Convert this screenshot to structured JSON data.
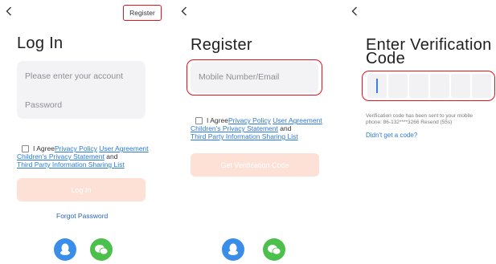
{
  "login": {
    "title": "Log In",
    "register_label": "Register",
    "account_placeholder": "Please enter your account",
    "password_placeholder": "Password",
    "agree_text": "I Agree",
    "privacy_policy": "Privacy Policy",
    "user_agreement": "User Agreement",
    "children_privacy": "Children's Privacy Statement",
    "and_text": "and",
    "third_party": "Third Party Information Sharing List",
    "login_button": "Log In",
    "forgot_password": "Forgot Password"
  },
  "register": {
    "title": "Register",
    "mobile_placeholder": "Mobile Number/Email",
    "agree_text": "I Agree",
    "privacy_policy": "Privacy Policy",
    "user_agreement": "User Agreement",
    "children_privacy": "Children's Privacy Statement",
    "and_text": "and",
    "third_party": "Third Party Information Sharing List",
    "button": "Get Verification Code"
  },
  "verify": {
    "title_line1": "Enter Verification",
    "title_line2": "Code",
    "sent_line1": "Verification code has been sent to your mobile",
    "sent_line2": "phone: 86-132****3266 Resend (55s)",
    "didnt_get": "Didn't get a code?"
  },
  "colors": {
    "accent_red": "#e0141a",
    "link_blue": "#2a7ad9",
    "disabled_button": "#fde0d6",
    "qq_blue": "#3a8eea",
    "wechat_green": "#4cc04c"
  },
  "icons": [
    "back-arrow-icon",
    "qq-icon",
    "wechat-icon"
  ]
}
